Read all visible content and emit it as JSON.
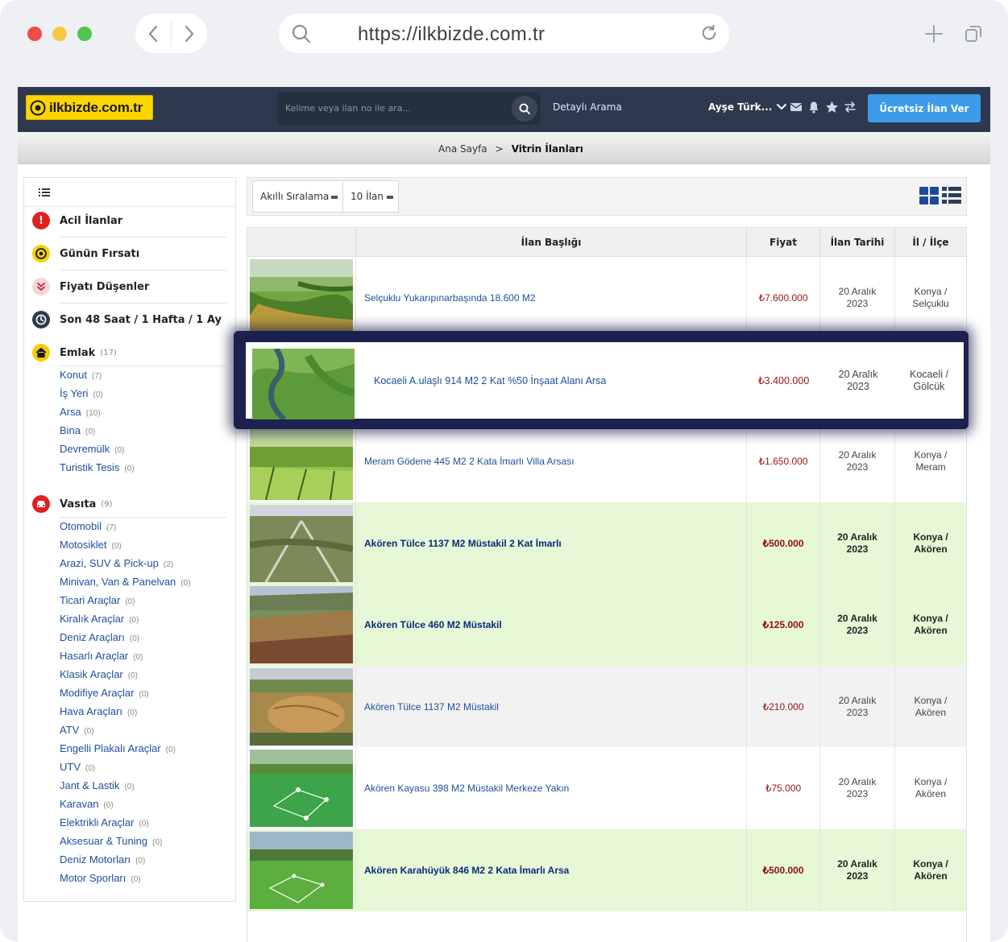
{
  "browser": {
    "url": "https://ilkbizde.com.tr",
    "traffic_colors": [
      "#ee4b4b",
      "#f6c945",
      "#4fc64c"
    ]
  },
  "header": {
    "logo_text": "ilkbizde.com.tr",
    "search_placeholder": "Kelime veya ilan no ile ara...",
    "detailed_search": "Detaylı Arama",
    "user_name": "Ayşe Türk...",
    "post_button": "Ücretsiz İlan Ver"
  },
  "breadcrumb": {
    "home": "Ana Sayfa",
    "separator": ">",
    "current": "Vitrin İlanları"
  },
  "sidebar": {
    "quick": [
      {
        "label": "Acil İlanlar",
        "icon": "exclamation-icon",
        "color": "#e02020"
      },
      {
        "label": "Günün Fırsatı",
        "icon": "target-icon",
        "color": "#f5d000"
      },
      {
        "label": "Fiyatı Düşenler",
        "icon": "double-chevron-down-icon",
        "color": "#f3d7da"
      },
      {
        "label": "Son 48 Saat / 1 Hafta / 1 Ay",
        "icon": "clock-icon",
        "color": "#2f3a4d"
      }
    ],
    "emlak": {
      "label": "Emlak",
      "count": "(17)",
      "items": [
        {
          "label": "Konut",
          "count": "(7)"
        },
        {
          "label": "İş Yeri",
          "count": "(0)"
        },
        {
          "label": "Arsa",
          "count": "(10)"
        },
        {
          "label": "Bina",
          "count": "(0)"
        },
        {
          "label": "Devremülk",
          "count": "(0)"
        },
        {
          "label": "Turistik Tesis",
          "count": "(0)"
        }
      ]
    },
    "vasita": {
      "label": "Vasıta",
      "count": "(9)",
      "items": [
        {
          "label": "Otomobil",
          "count": "(7)"
        },
        {
          "label": "Motosiklet",
          "count": "(0)"
        },
        {
          "label": "Arazi, SUV & Pick-up",
          "count": "(2)"
        },
        {
          "label": "Minivan, Van & Panelvan",
          "count": "(0)"
        },
        {
          "label": "Ticari Araçlar",
          "count": "(0)"
        },
        {
          "label": "Kiralık Araçlar",
          "count": "(0)"
        },
        {
          "label": "Deniz Araçları",
          "count": "(0)"
        },
        {
          "label": "Hasarlı Araçlar",
          "count": "(0)"
        },
        {
          "label": "Klasik Araçlar",
          "count": "(0)"
        },
        {
          "label": "Modifiye Araçlar",
          "count": "(0)"
        },
        {
          "label": "Hava Araçları",
          "count": "(0)"
        },
        {
          "label": "ATV",
          "count": "(0)"
        },
        {
          "label": "Engelli Plakalı Araçlar",
          "count": "(0)"
        },
        {
          "label": "UTV",
          "count": "(0)"
        },
        {
          "label": "Jant & Lastik",
          "count": "(0)"
        },
        {
          "label": "Karavan",
          "count": "(0)"
        },
        {
          "label": "Elektrikli Araçlar",
          "count": "(0)"
        },
        {
          "label": "Aksesuar & Tuning",
          "count": "(0)"
        },
        {
          "label": "Deniz Motorları",
          "count": "(0)"
        },
        {
          "label": "Motor Sporları",
          "count": "(0)"
        }
      ]
    }
  },
  "toolbar": {
    "sort": "Akıllı Sıralama",
    "per_page": "10 İlan"
  },
  "table": {
    "headers": {
      "title": "İlan Başlığı",
      "price": "Fiyat",
      "date": "İlan Tarihi",
      "location": "İl / İlçe"
    },
    "rows": [
      {
        "title": "Selçuklu Yukarıpınarbaşında 18.600 M2",
        "price": "₺7.600.000",
        "date": [
          "20 Aralık",
          "2023"
        ],
        "loc": [
          "Konya /",
          "Selçuklu"
        ],
        "highlight": false
      },
      {
        "title": "Kocaeli A.ulaşlı 914 M2 2 Kat %50 İnşaat Alanı Arsa",
        "price": "₺3.400.000",
        "date": [
          "20 Aralık",
          "2023"
        ],
        "loc": [
          "Kocaeli /",
          "Gölcük"
        ],
        "highlight": false
      },
      {
        "title": "Meram Gödene 445 M2 2 Kata İmarlı Villa Arsası",
        "price": "₺1.650.000",
        "date": [
          "20 Aralık",
          "2023"
        ],
        "loc": [
          "Konya /",
          "Meram"
        ],
        "highlight": false
      },
      {
        "title": "Akören Tülce 1137 M2 Müstakil 2 Kat İmarlı",
        "price": "₺500.000",
        "date": [
          "20 Aralık",
          "2023"
        ],
        "loc": [
          "Konya /",
          "Akören"
        ],
        "highlight": true
      },
      {
        "title": "Akören Tülce 460 M2 Müstakil",
        "price": "₺125.000",
        "date": [
          "20 Aralık",
          "2023"
        ],
        "loc": [
          "Konya /",
          "Akören"
        ],
        "highlight": true
      },
      {
        "title": "Akören Tülce 1137 M2 Müstakil",
        "price": "₺210.000",
        "date": [
          "20 Aralık",
          "2023"
        ],
        "loc": [
          "Konya /",
          "Akören"
        ],
        "highlight": false
      },
      {
        "title": "Akören Kayasu 398 M2 Müstakil Merkeze Yakın",
        "price": "₺75.000",
        "date": [
          "20 Aralık",
          "2023"
        ],
        "loc": [
          "Konya /",
          "Akören"
        ],
        "highlight": false
      },
      {
        "title": "Akören Karahüyük 846 M2 2 Kata İmarlı Arsa",
        "price": "₺500.000",
        "date": [
          "20 Aralık",
          "2023"
        ],
        "loc": [
          "Konya /",
          "Akören"
        ],
        "highlight": true
      }
    ]
  },
  "colors": {
    "topbar": "#2e394f",
    "accent": "#3d9be9",
    "highlight_row": "#e6f8d6",
    "alt_row": "#f2f2f2",
    "price": "#9b1414",
    "link": "#1f4e9a"
  }
}
